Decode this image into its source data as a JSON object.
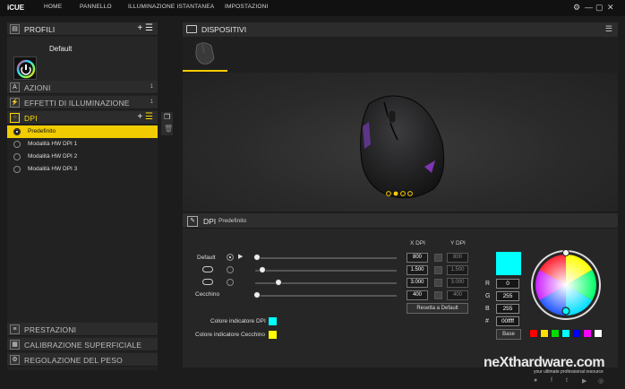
{
  "app": {
    "title": "iCUE"
  },
  "nav": [
    "HOME",
    "PANNELLO",
    "ILLUMINAZIONE ISTANTANEA",
    "IMPOSTAZIONI"
  ],
  "window_controls": [
    "⚙",
    "—",
    "▢",
    "✕"
  ],
  "left": {
    "profiles_label": "PROFILI",
    "profile_name": "Default",
    "sections": [
      {
        "label": "AZIONI",
        "count": "1"
      },
      {
        "label": "EFFETTI DI ILLUMINAZIONE",
        "count": "1"
      }
    ],
    "dpi_label": "DPI",
    "dpi_items": [
      "Predefinito",
      "Modalità HW DPI 1",
      "Modalità HW DPI 2",
      "Modalità HW DPI 3"
    ],
    "bottom_sections": [
      "PRESTAZIONI",
      "CALIBRAZIONE SUPERFICIALE",
      "REGOLAZIONE DEL PESO"
    ]
  },
  "devices": {
    "label": "DISPOSITIVI"
  },
  "dpi_panel": {
    "title": "DPI",
    "subtitle": "Predefinito",
    "col_x": "X DPI",
    "col_y": "Y DPI",
    "rows": [
      {
        "label": "Default",
        "x": "800",
        "y": "800",
        "level": 0.0
      },
      {
        "label": "",
        "x": "1.500",
        "y": "1.500",
        "level": 0.04
      },
      {
        "label": "",
        "x": "3.000",
        "y": "3.000",
        "level": 0.15
      },
      {
        "label": "Cecchino",
        "x": "400",
        "y": "400",
        "level": 0.0
      }
    ],
    "reset_label": "Resetta a Default",
    "indicator_dpi_label": "Colore indicatore DPI",
    "indicator_sniper_label": "Colore indicatore Cecchino",
    "indicator_dpi_color": "#00ffff",
    "indicator_sniper_color": "#ffff00"
  },
  "color": {
    "r_label": "R",
    "g_label": "G",
    "b_label": "B",
    "hex_label": "#",
    "r": "0",
    "g": "255",
    "b": "255",
    "hex": "00ffff",
    "preview": "#00ffff",
    "base_label": "Base",
    "palette": [
      "#ff0000",
      "#ffdd00",
      "#00dd00",
      "#00ffff",
      "#0000ff",
      "#ff00ff",
      "#ffffff"
    ]
  },
  "watermark": {
    "brand": "neXthardware.com",
    "tagline": "your ultimate professional resource"
  }
}
